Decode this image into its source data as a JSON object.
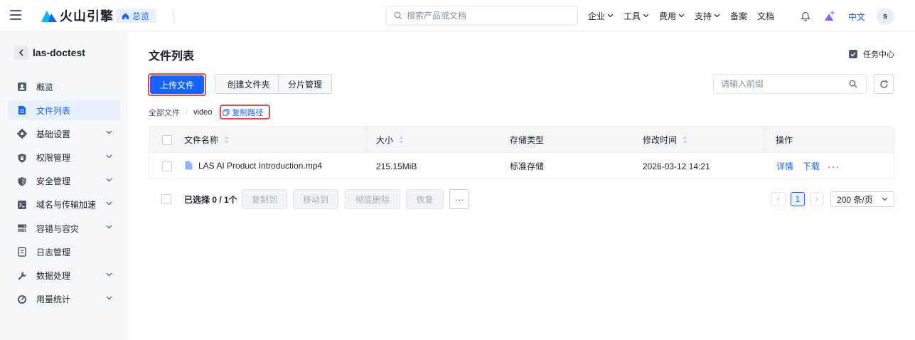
{
  "topbar": {
    "brand": "火山引擎",
    "home_label": "总览",
    "search_placeholder": "搜索产品或文档",
    "nav": [
      {
        "label": "企业",
        "has_dropdown": true
      },
      {
        "label": "工具",
        "has_dropdown": true
      },
      {
        "label": "费用",
        "has_dropdown": true
      },
      {
        "label": "支持",
        "has_dropdown": true
      },
      {
        "label": "备案",
        "has_dropdown": false
      },
      {
        "label": "文档",
        "has_dropdown": false
      }
    ],
    "language": "中文",
    "avatar_initial": "s"
  },
  "sidebar": {
    "bucket_name": "las-doctest",
    "items": [
      {
        "label": "概览",
        "icon": "overview-icon",
        "expandable": false,
        "active": false
      },
      {
        "label": "文件列表",
        "icon": "file-list-icon",
        "expandable": false,
        "active": true
      },
      {
        "label": "基础设置",
        "icon": "gear-icon",
        "expandable": true,
        "active": false
      },
      {
        "label": "权限管理",
        "icon": "shield-lock-icon",
        "expandable": true,
        "active": false
      },
      {
        "label": "安全管理",
        "icon": "shield-icon",
        "expandable": true,
        "active": false
      },
      {
        "label": "域名与传输加速",
        "icon": "terminal-icon",
        "expandable": true,
        "active": false
      },
      {
        "label": "容错与容灾",
        "icon": "server-icon",
        "expandable": true,
        "active": false
      },
      {
        "label": "日志管理",
        "icon": "log-icon",
        "expandable": false,
        "active": false
      },
      {
        "label": "数据处理",
        "icon": "wrench-icon",
        "expandable": true,
        "active": false
      },
      {
        "label": "用量统计",
        "icon": "gauge-icon",
        "expandable": true,
        "active": false
      }
    ]
  },
  "main": {
    "title": "文件列表",
    "task_center": "任务中心",
    "toolbar": {
      "upload": "上传文件",
      "create_folder": "创建文件夹",
      "multipart": "分片管理",
      "prefix_placeholder": "请输入前缀"
    },
    "breadcrumb": {
      "root": "全部文件",
      "current": "video",
      "copy_path": "复制路径"
    },
    "table": {
      "columns": [
        "文件名称",
        "大小",
        "存储类型",
        "修改时间",
        "操作"
      ],
      "rows": [
        {
          "name": "LAS AI Product Introduction.mp4",
          "size": "215.15MiB",
          "storage_class": "标准存储",
          "modified": "2026-03-12 14:21",
          "actions": [
            "详情",
            "下载"
          ],
          "more": "···"
        }
      ]
    },
    "footer": {
      "selected": "已选择 0 / 1个",
      "actions": [
        "复制到",
        "移动到",
        "彻底删除",
        "恢复"
      ],
      "more": "···",
      "current_page": "1",
      "page_size": "200 条/页"
    }
  },
  "colors": {
    "primary": "#1664ff",
    "highlight_ring": "#e5484d",
    "sidebar_bg": "#f7f8fa",
    "active_bg": "#e8effd"
  }
}
